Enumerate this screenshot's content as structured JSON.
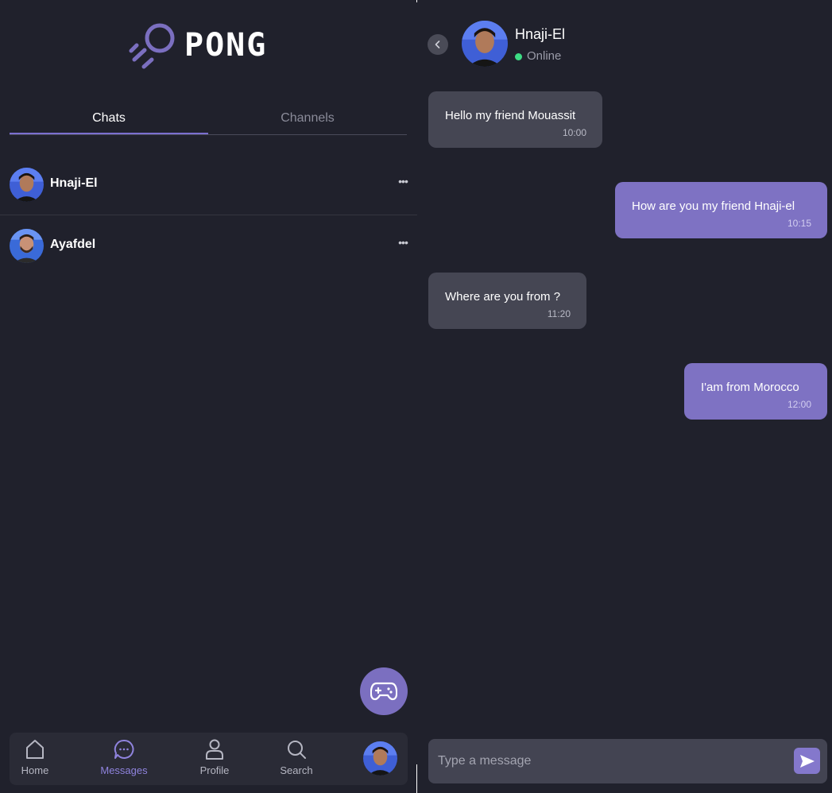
{
  "app": {
    "logo_text": "PONG",
    "accent_color": "#7b6fd0",
    "background_color": "#20212c"
  },
  "left_panel": {
    "tabs": [
      {
        "label": "Chats",
        "active": true
      },
      {
        "label": "Channels",
        "active": false
      }
    ],
    "chats": [
      {
        "name": "Hnaji-El",
        "more_icon": "ellipsis-icon"
      },
      {
        "name": "Ayafdel",
        "more_icon": "ellipsis-icon"
      }
    ],
    "fab_icon": "gamepad-icon",
    "bottom_nav": [
      {
        "label": "Home",
        "icon": "home-icon",
        "active": false
      },
      {
        "label": "Messages",
        "icon": "chat-bubble-icon",
        "active": true
      },
      {
        "label": "Profile",
        "icon": "user-icon",
        "active": false
      },
      {
        "label": "Search",
        "icon": "search-icon",
        "active": false
      }
    ]
  },
  "conversation": {
    "contact_name": "Hnaji-El",
    "status": "Online",
    "status_color": "#3ddc84",
    "messages": [
      {
        "text": "Hello my friend Mouassit",
        "time": "10:00",
        "direction": "incoming"
      },
      {
        "text": "How are you my friend Hnaji-el",
        "time": "10:15",
        "direction": "outgoing"
      },
      {
        "text": "Where are you from ?",
        "time": "11:20",
        "direction": "incoming"
      },
      {
        "text": "I'am from Morocco",
        "time": "12:00",
        "direction": "outgoing"
      }
    ],
    "composer": {
      "placeholder": "Type a message",
      "value": "",
      "send_icon": "send-icon"
    }
  }
}
